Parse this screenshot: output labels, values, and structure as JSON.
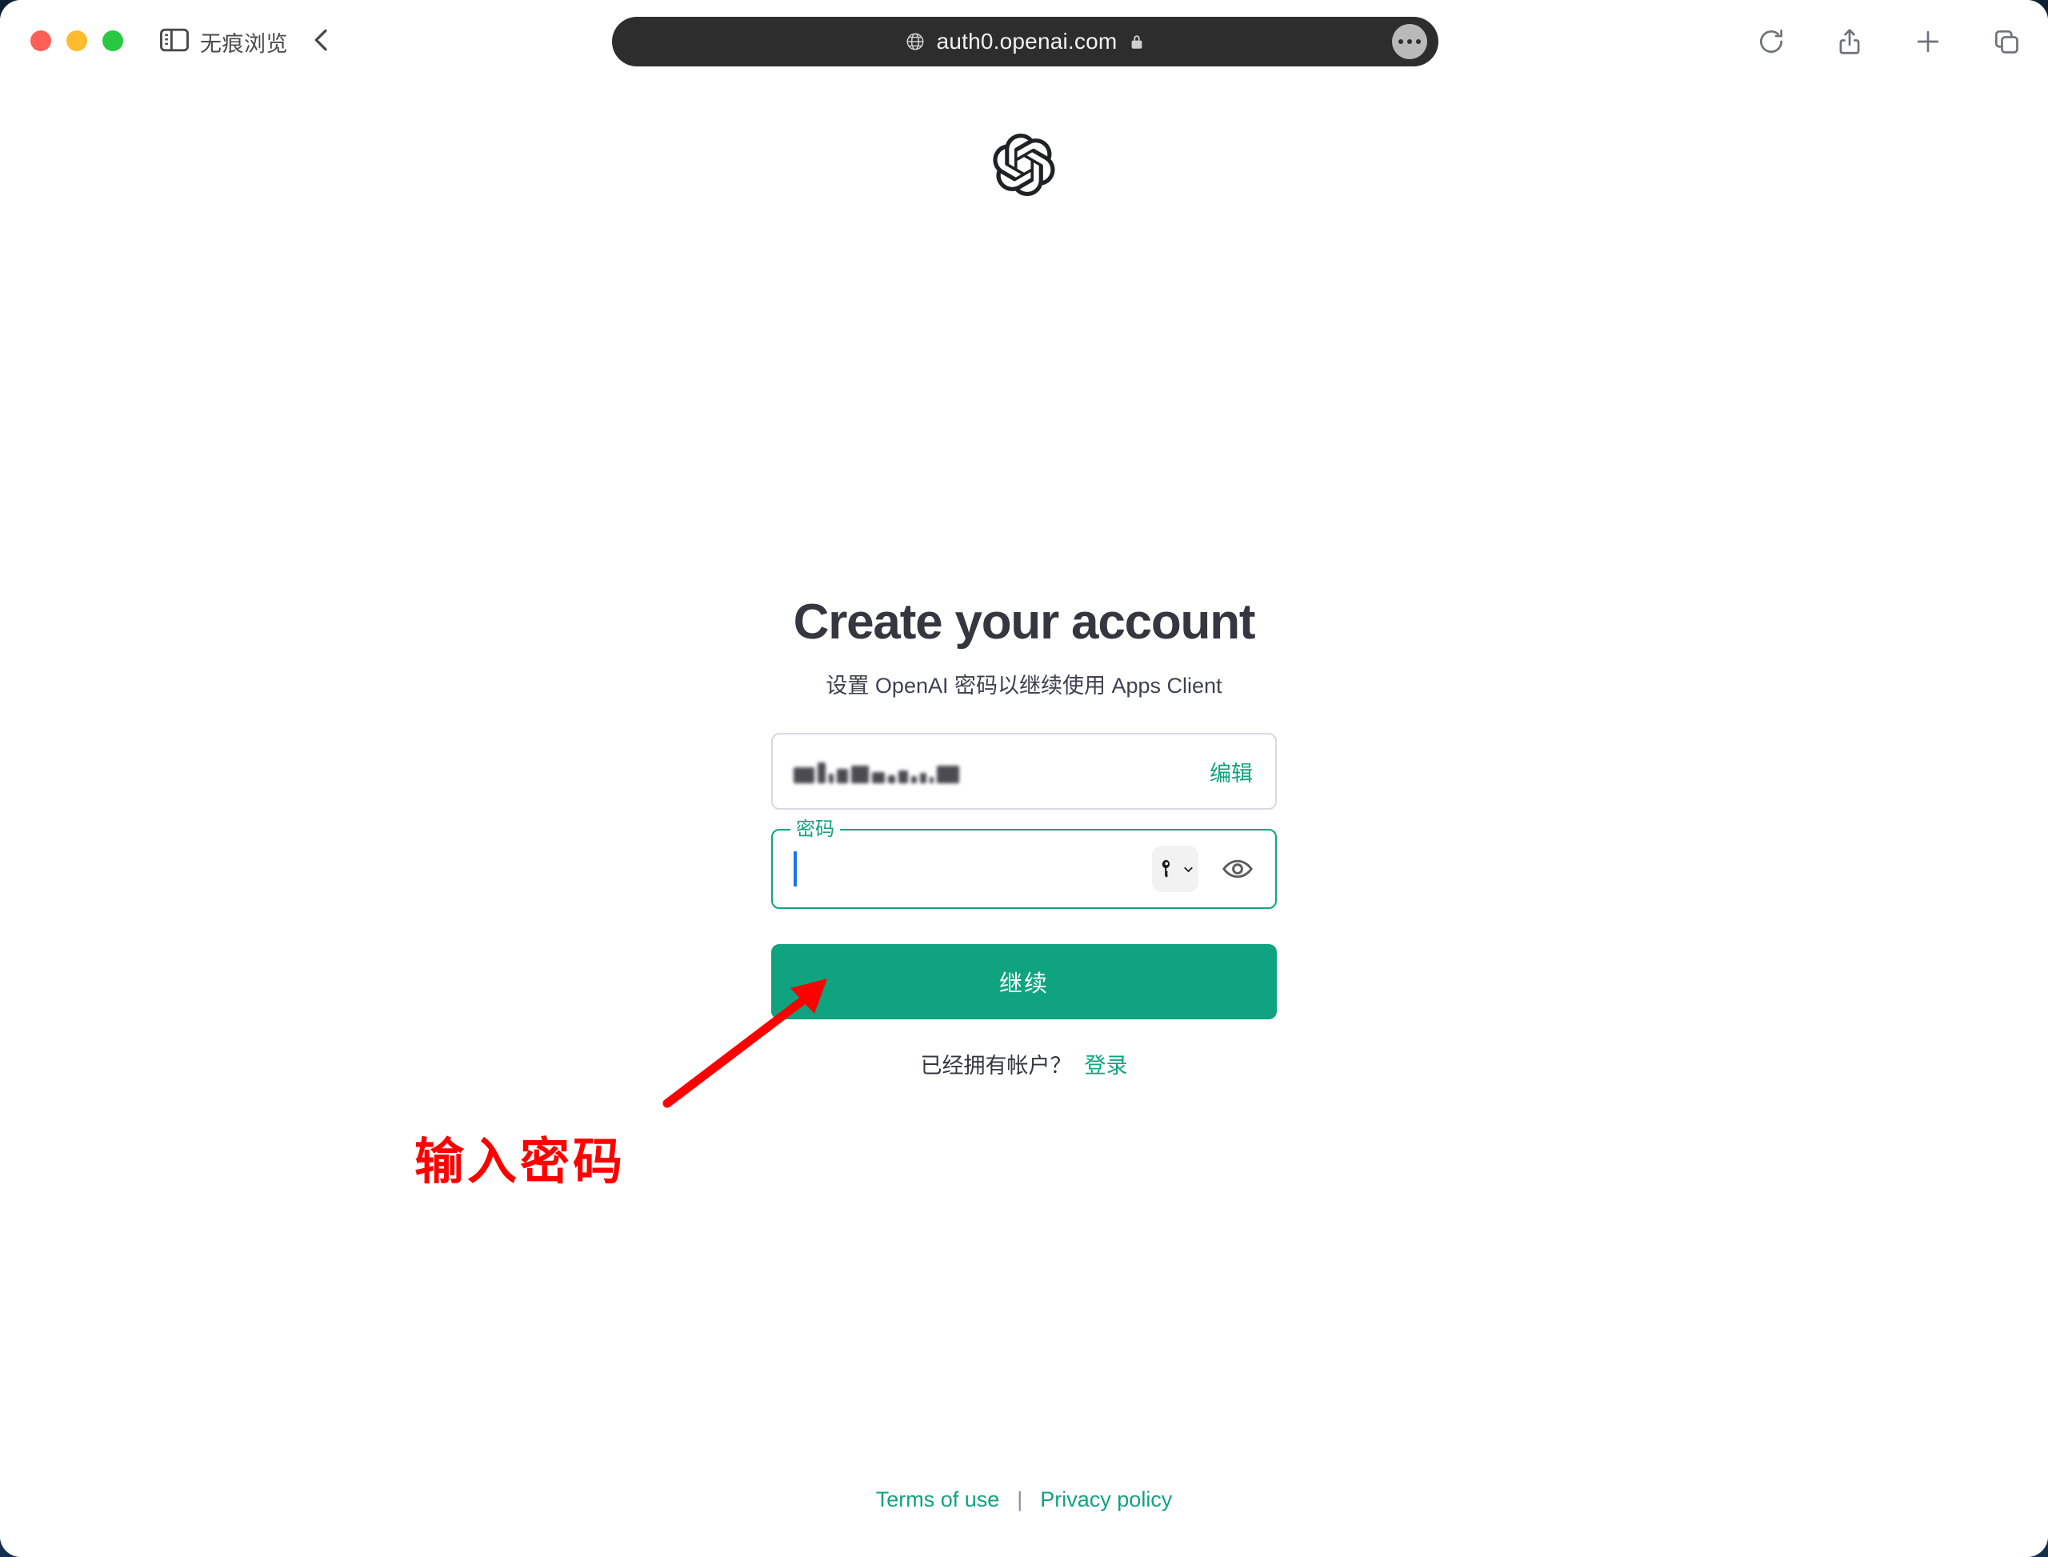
{
  "browser": {
    "traffic_lights": [
      "close",
      "minimize",
      "zoom"
    ],
    "sidebar_icon": "sidebar-icon",
    "private_mode_label": "无痕浏览",
    "back_icon": "chevron-left-icon",
    "address_bar": {
      "globe_icon": "globe-icon",
      "url": "auth0.openai.com",
      "lock_icon": "lock-icon",
      "more_icon": "ellipsis-icon"
    },
    "right_tools": [
      {
        "name": "reload-button",
        "icon": "reload-icon"
      },
      {
        "name": "share-button",
        "icon": "share-icon"
      },
      {
        "name": "new-tab-button",
        "icon": "plus-icon"
      },
      {
        "name": "tab-overview-button",
        "icon": "tabs-icon"
      }
    ]
  },
  "page": {
    "logo": "openai-logo",
    "title": "Create your account",
    "subtitle": "设置 OpenAI 密码以继续使用 Apps Client",
    "email_field": {
      "value_masked": "••••••••••••••",
      "edit_label": "编辑"
    },
    "password_field": {
      "label": "密码",
      "value": "",
      "placeholder": "",
      "autofill_icon": "key-chevron-icon",
      "reveal_icon": "eye-icon"
    },
    "continue_label": "继续",
    "signin_prompt": "已经拥有帐户？",
    "signin_label": "登录",
    "footer": {
      "terms_label": "Terms of use",
      "separator": "|",
      "privacy_label": "Privacy policy"
    }
  },
  "annotation": {
    "text": "输入密码",
    "color": "#ff0000",
    "arrow_icon": "arrow-pointer-icon"
  },
  "colors": {
    "accent_green": "#10a37f",
    "title_gray": "#353740",
    "url_bar_dark": "#2d2d2d",
    "caret_blue": "#1a73e8",
    "annotation_red": "#ff0000"
  }
}
